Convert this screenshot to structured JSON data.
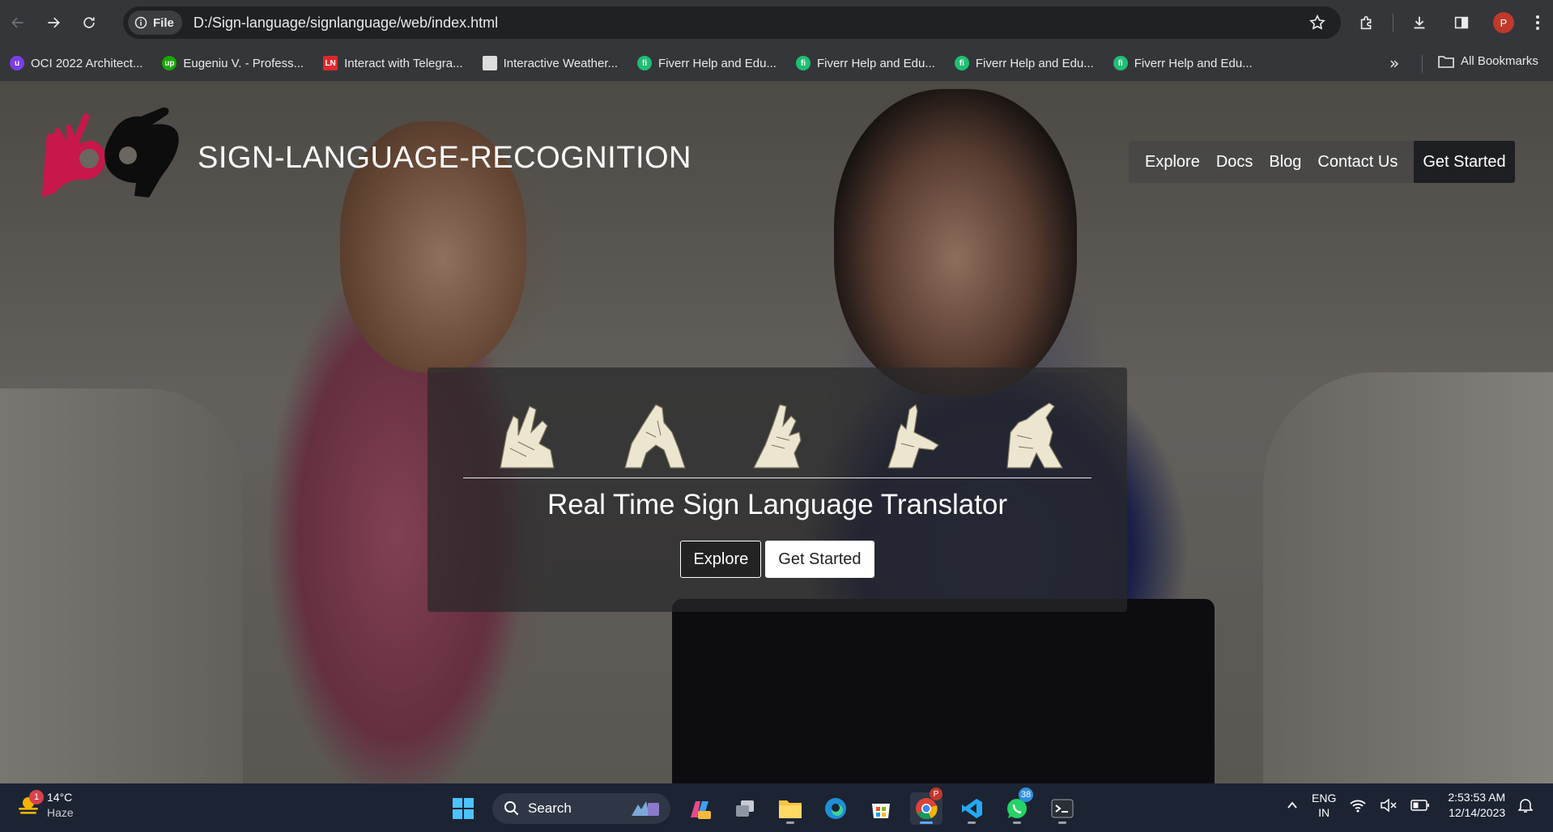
{
  "browser": {
    "scheme_label": "File",
    "url": "D:/Sign-language/signlanguage/web/index.html",
    "profile_initial": "P",
    "bookmarks": [
      {
        "label": "OCI 2022 Architect...",
        "icon": "oci-icon",
        "color": "#7b3fe4"
      },
      {
        "label": "Eugeniu V. - Profess...",
        "icon": "upwork-icon",
        "color": "#14a800"
      },
      {
        "label": "Interact with Telegra...",
        "icon": "ln-icon",
        "color": "#e0282d"
      },
      {
        "label": "Interactive Weather...",
        "icon": "page-icon",
        "color": "#dddddd"
      },
      {
        "label": "Fiverr Help and Edu...",
        "icon": "fiverr-icon",
        "color": "#1dbf73"
      },
      {
        "label": "Fiverr Help and Edu...",
        "icon": "fiverr-icon",
        "color": "#1dbf73"
      },
      {
        "label": "Fiverr Help and Edu...",
        "icon": "fiverr-icon",
        "color": "#1dbf73"
      },
      {
        "label": "Fiverr Help and Edu...",
        "icon": "fiverr-icon",
        "color": "#1dbf73"
      }
    ],
    "all_bookmarks": "All Bookmarks"
  },
  "site": {
    "title": "SIGN-LANGUAGE-RECOGNITION",
    "nav": {
      "explore": "Explore",
      "docs": "Docs",
      "blog": "Blog",
      "contact": "Contact Us",
      "get_started": "Get Started"
    },
    "hero": {
      "title": "Real Time Sign Language Translator",
      "explore": "Explore",
      "get_started": "Get Started"
    },
    "colors": {
      "logo_red": "#c8174a",
      "logo_black": "#0d0d0d"
    }
  },
  "taskbar": {
    "weather_badge": "1",
    "temperature": "14°C",
    "condition": "Haze",
    "search_label": "Search",
    "chrome_badge": "P",
    "whatsapp_badge": "38",
    "lang_line1": "ENG",
    "lang_line2": "IN",
    "time": "2:53:53 AM",
    "date": "12/14/2023"
  }
}
